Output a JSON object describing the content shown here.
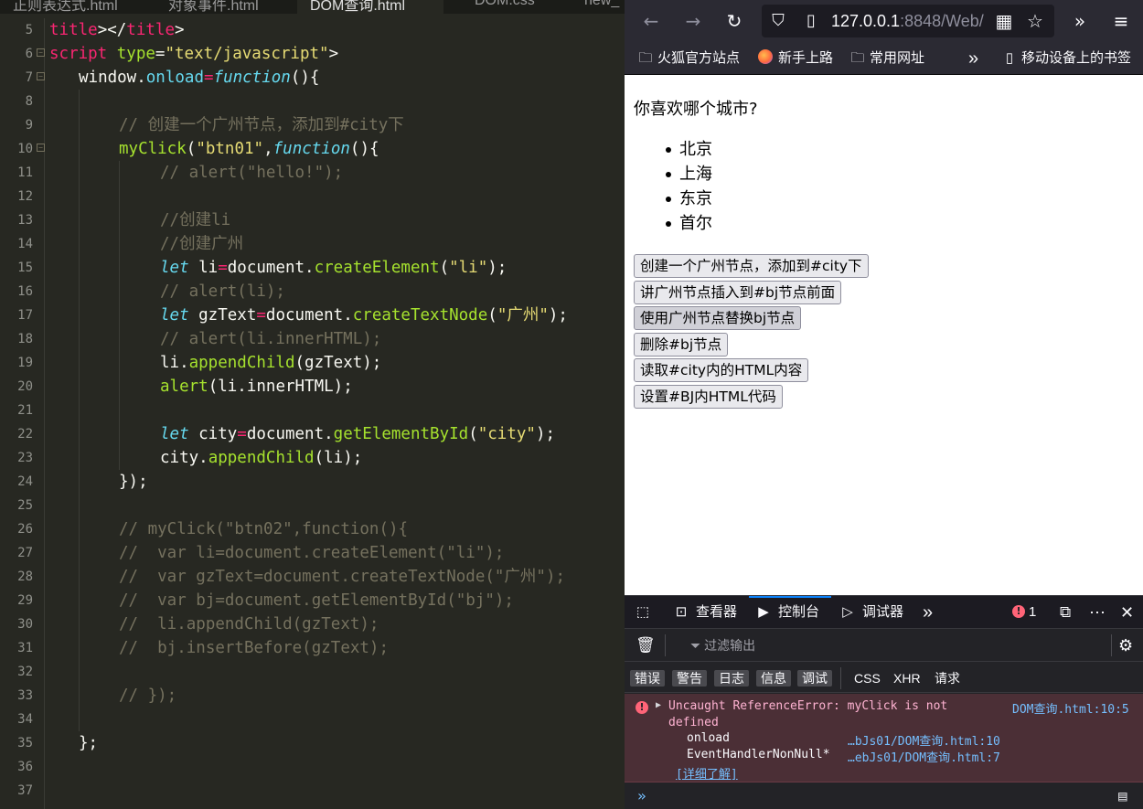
{
  "editor": {
    "tabs": [
      {
        "label": "正则表达式.html",
        "active": false
      },
      {
        "label": "对象事件.html",
        "active": false
      },
      {
        "label": "DOM查询.html",
        "active": true
      },
      {
        "label": "DOM.css",
        "active": false
      },
      {
        "label": "new_",
        "active": false
      }
    ],
    "line_numbers": [
      "5",
      "6",
      "7",
      "8",
      "9",
      "10",
      "11",
      "12",
      "13",
      "14",
      "15",
      "16",
      "17",
      "18",
      "19",
      "20",
      "21",
      "22",
      "23",
      "24",
      "25",
      "26",
      "27",
      "28",
      "29",
      "30",
      "31",
      "32",
      "33",
      "34",
      "35",
      "36",
      "37"
    ],
    "code": {
      "l5": [
        "title",
        "></",
        "title",
        ">"
      ],
      "l6": [
        "script",
        " ",
        "type",
        "=",
        "\"text/javascript\"",
        ">"
      ],
      "l7": [
        "window",
        ".",
        "onload",
        "=",
        "function",
        "(){"
      ],
      "l9": "// 创建一个广州节点，添加到#city下",
      "l10": [
        "myClick",
        "(",
        "\"btn01\"",
        ",",
        "function",
        "(){"
      ],
      "l11": "// alert(\"hello!\");",
      "l13": "//创建li",
      "l14": "//创建广州",
      "l15": [
        "let",
        " li",
        "=",
        "document.",
        "createElement",
        "(",
        "\"li\"",
        ");"
      ],
      "l16": "// alert(li);",
      "l17": [
        "let",
        " gzText",
        "=",
        "document.",
        "createTextNode",
        "(",
        "\"广州\"",
        ");"
      ],
      "l18": "// alert(li.innerHTML);",
      "l19": [
        "li.",
        "appendChild",
        "(gzText);"
      ],
      "l20": [
        "alert",
        "(li.innerHTML);"
      ],
      "l22": [
        "let",
        " city",
        "=",
        "document.",
        "getElementById",
        "(",
        "\"city\"",
        ");"
      ],
      "l23": [
        "city.",
        "appendChild",
        "(li);"
      ],
      "l24": "});",
      "l26": "// myClick(\"btn02\",function(){",
      "l27": "//  var li=document.createElement(\"li\");",
      "l28": "//  var gzText=document.createTextNode(\"广州\");",
      "l29": "//  var bj=document.getElementById(\"bj\");",
      "l30": "//  li.appendChild(gzText);",
      "l31": "//  bj.insertBefore(gzText);",
      "l33": "// });",
      "l35": "};"
    }
  },
  "browser": {
    "url_host": "127.0.0.1",
    "url_rest": ":8848/Web/",
    "bookmarks": [
      "火狐官方站点",
      "新手上路",
      "常用网址",
      "移动设备上的书签"
    ],
    "page": {
      "question": "你喜欢哪个城市?",
      "cities": [
        "北京",
        "上海",
        "东京",
        "首尔"
      ],
      "buttons": [
        "创建一个广州节点，添加到#city下",
        "讲广州节点插入到#bj节点前面",
        "使用广州节点替换bj节点",
        "删除#bj节点",
        "读取#city内的HTML内容",
        "设置#BJ内HTML代码"
      ]
    },
    "devtools": {
      "tabs": [
        "查看器",
        "控制台",
        "调试器"
      ],
      "active_tab": "控制台",
      "error_count": "1",
      "filter_placeholder": "过滤输出",
      "levels": [
        "错误",
        "警告",
        "日志",
        "信息",
        "调试"
      ],
      "extra_filters": [
        "CSS",
        "XHR",
        "请求"
      ],
      "error": {
        "message_line1": "Uncaught ReferenceError: myClick is not",
        "message_line2": "defined",
        "source": "DOM查询.html:10:5",
        "stack": [
          {
            "fn": "onload",
            "loc": "…bJs01/DOM查询.html:10"
          },
          {
            "fn": "EventHandlerNonNull*",
            "loc": "…ebJs01/DOM查询.html:7"
          }
        ],
        "learn_more": "[详细了解]"
      }
    }
  },
  "colors": {
    "editor_bg": "#272822",
    "keyword": "#66d9ef",
    "function": "#a6e22e",
    "string": "#e6db74",
    "tag": "#f92672",
    "comment": "#75715e",
    "toolbar_bg": "#2b2a33",
    "error_bg": "#4b2f36"
  }
}
